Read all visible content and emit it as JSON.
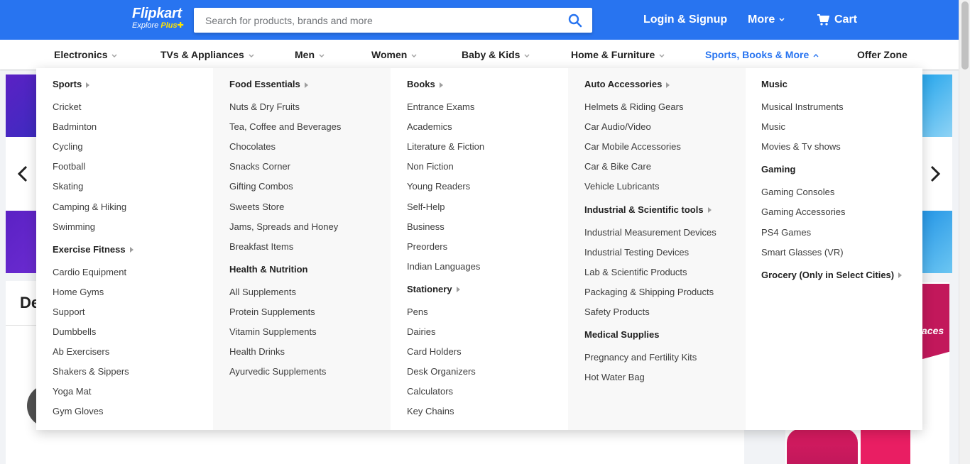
{
  "header": {
    "logo": {
      "name": "Flipkart",
      "sub": "Explore",
      "plus": "Plus"
    },
    "search": {
      "placeholder": "Search for products, brands and more"
    },
    "login_label": "Login & Signup",
    "more_label": "More",
    "cart_label": "Cart"
  },
  "nav": {
    "categories": [
      {
        "label": "Electronics",
        "has_chevron": true,
        "active": false
      },
      {
        "label": "TVs & Appliances",
        "has_chevron": true,
        "active": false
      },
      {
        "label": "Men",
        "has_chevron": true,
        "active": false
      },
      {
        "label": "Women",
        "has_chevron": true,
        "active": false
      },
      {
        "label": "Baby & Kids",
        "has_chevron": true,
        "active": false
      },
      {
        "label": "Home & Furniture",
        "has_chevron": true,
        "active": false
      },
      {
        "label": "Sports, Books & More",
        "has_chevron": true,
        "active": true
      },
      {
        "label": "Offer Zone",
        "has_chevron": false,
        "active": false
      }
    ]
  },
  "background": {
    "deals_title": "De",
    "promo_text": "aces"
  },
  "menu": {
    "columns": [
      {
        "groups": [
          {
            "title": "Sports",
            "caret": true,
            "items": [
              "Cricket",
              "Badminton",
              "Cycling",
              "Football",
              "Skating",
              "Camping & Hiking",
              "Swimming"
            ]
          },
          {
            "title": "Exercise Fitness",
            "caret": true,
            "items": [
              "Cardio Equipment",
              "Home Gyms",
              "Support",
              "Dumbbells",
              "Ab Exercisers",
              "Shakers & Sippers",
              "Yoga Mat",
              "Gym Gloves"
            ]
          }
        ]
      },
      {
        "groups": [
          {
            "title": "Food Essentials",
            "caret": true,
            "items": [
              "Nuts & Dry Fruits",
              "Tea, Coffee and Beverages",
              "Chocolates",
              "Snacks Corner",
              "Gifting Combos",
              "Sweets Store",
              "Jams, Spreads and Honey",
              "Breakfast Items"
            ]
          },
          {
            "title": "Health & Nutrition",
            "caret": false,
            "items": [
              "All Supplements",
              "Protein Supplements",
              "Vitamin Supplements",
              "Health Drinks",
              "Ayurvedic Supplements"
            ]
          }
        ]
      },
      {
        "groups": [
          {
            "title": "Books",
            "caret": true,
            "items": [
              "Entrance Exams",
              "Academics",
              "Literature & Fiction",
              "Non Fiction",
              "Young Readers",
              "Self-Help",
              "Business",
              "Preorders",
              "Indian Languages"
            ]
          },
          {
            "title": "Stationery",
            "caret": true,
            "items": [
              "Pens",
              "Dairies",
              "Card Holders",
              "Desk Organizers",
              "Calculators",
              "Key Chains"
            ]
          }
        ]
      },
      {
        "groups": [
          {
            "title": "Auto Accessories",
            "caret": true,
            "items": [
              "Helmets & Riding Gears",
              "Car Audio/Video",
              "Car Mobile Accessories",
              "Car & Bike Care",
              "Vehicle Lubricants"
            ]
          },
          {
            "title": "Industrial & Scientific tools",
            "caret": true,
            "items": [
              "Industrial Measurement Devices",
              "Industrial Testing Devices",
              "Lab & Scientific Products",
              "Packaging & Shipping Products",
              "Safety Products"
            ]
          },
          {
            "title": "Medical Supplies",
            "caret": false,
            "items": [
              "Pregnancy and Fertility Kits",
              "Hot Water Bag"
            ]
          }
        ]
      },
      {
        "groups": [
          {
            "title": "Music",
            "caret": false,
            "items": [
              "Musical Instruments",
              "Music",
              "Movies & Tv shows"
            ]
          },
          {
            "title": "Gaming",
            "caret": false,
            "items": [
              "Gaming Consoles",
              "Gaming Accessories",
              "PS4 Games",
              "Smart Glasses (VR)"
            ]
          },
          {
            "title": "Grocery (Only in Select Cities)",
            "caret": true,
            "items": []
          }
        ]
      }
    ]
  }
}
